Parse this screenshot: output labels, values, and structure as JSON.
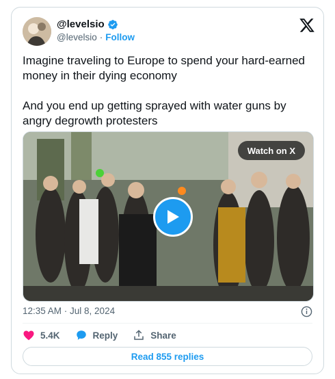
{
  "author": {
    "display_name": "@levelsio",
    "handle": "@levelsio",
    "separator": "·",
    "follow_label": "Follow"
  },
  "tweet": {
    "paragraphs": [
      "Imagine traveling to Europe to spend your hard-earned money in their dying economy",
      "And you end up getting sprayed with water guns by angry degrowth protesters"
    ],
    "timestamp": "12:35 AM · Jul 8, 2024"
  },
  "media": {
    "watch_label": "Watch on X"
  },
  "actions": {
    "likes": "5.4K",
    "reply_label": "Reply",
    "share_label": "Share"
  },
  "read_replies_label": "Read 855 replies",
  "colors": {
    "accent": "#1d9bf0",
    "like": "#f91880",
    "muted": "#536471",
    "border": "#cfd9de"
  },
  "icons": [
    "verified-badge-icon",
    "x-logo-icon",
    "play-icon",
    "info-icon",
    "heart-icon",
    "reply-bubble-icon",
    "share-icon"
  ]
}
